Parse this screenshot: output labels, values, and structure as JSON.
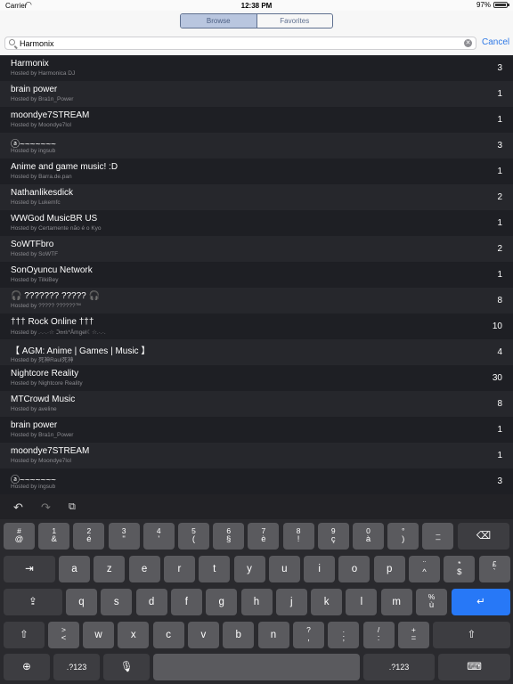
{
  "status": {
    "carrier": "Carrier",
    "time": "12:38 PM",
    "battery": "97%",
    "battery_level": 0.97
  },
  "tabs": [
    {
      "label": "Browse",
      "active": true
    },
    {
      "label": "Favorites",
      "active": false
    }
  ],
  "search": {
    "value": "Harmonix",
    "cancel_label": "Cancel"
  },
  "results": [
    {
      "title": "Harmonix",
      "host": "Hosted by Harmonica DJ",
      "count": "3"
    },
    {
      "title": "brain power",
      "host": "Hosted by Bra1n_Power",
      "count": "1"
    },
    {
      "title": "moondye7STREAM",
      "host": "Hosted by Moondye7lol",
      "count": "1"
    },
    {
      "title": "ⓐ~~~~~~~",
      "host": "Hosted by ingsub",
      "count": "3"
    },
    {
      "title": "Anime and game music! :D",
      "host": "Hosted by Barra.de.pan",
      "count": "1"
    },
    {
      "title": "Nathanlikesdick",
      "host": "Hosted by Lukemfc",
      "count": "2"
    },
    {
      "title": "WWGod MusicBR US",
      "host": "Hosted by Certamente não é o Kyo",
      "count": "1"
    },
    {
      "title": "SoWTFbro",
      "host": "Hosted by SoWTF",
      "count": "2"
    },
    {
      "title": "SonOyuncu Network",
      "host": "Hosted by TilkiBey",
      "count": "1"
    },
    {
      "title": "🎧 ??????? ????? 🎧",
      "host": "Hosted by ????? ??????™",
      "count": "8"
    },
    {
      "title": "††† Rock Online †††",
      "host": "Hosted by .·.·.·☆ ℑ𝔞𝔫𝔨*Åmgel☾☆.·.·.",
      "count": "10"
    },
    {
      "title": "【 AGM: Anime | Games | Music 】",
      "host": "Hosted by 死神Raul死神",
      "count": "4"
    },
    {
      "title": "Nightcore Reality",
      "host": "Hosted by Nightcore Reality",
      "count": "30"
    },
    {
      "title": "MTCrowd Music",
      "host": "Hosted by aveline",
      "count": "8"
    },
    {
      "title": "brain power",
      "host": "Hosted by Bra1n_Power",
      "count": "1"
    },
    {
      "title": "moondye7STREAM",
      "host": "Hosted by Moondye7lol",
      "count": "1"
    },
    {
      "title": "ⓐ~~~~~~~",
      "host": "Hosted by ingsub",
      "count": "3"
    }
  ],
  "keyboard": {
    "toolbar": {
      "undo": "↶",
      "redo": "↷",
      "paste": "⧉"
    },
    "row1": [
      {
        "top": "#",
        "bot": "@"
      },
      {
        "top": "1",
        "bot": "&"
      },
      {
        "top": "2",
        "bot": "é"
      },
      {
        "top": "3",
        "bot": "\""
      },
      {
        "top": "4",
        "bot": "'"
      },
      {
        "top": "5",
        "bot": "("
      },
      {
        "top": "6",
        "bot": "§"
      },
      {
        "top": "7",
        "bot": "è"
      },
      {
        "top": "8",
        "bot": "!"
      },
      {
        "top": "9",
        "bot": "ç"
      },
      {
        "top": "0",
        "bot": "à"
      },
      {
        "top": "°",
        "bot": ")"
      },
      {
        "top": "_",
        "bot": "–"
      }
    ],
    "delete": "⌫",
    "tab": "⇥",
    "row2": [
      "a",
      "z",
      "e",
      "r",
      "t",
      "y",
      "u",
      "i",
      "o",
      "p"
    ],
    "row2_extra": [
      {
        "top": "¨",
        "bot": "^"
      },
      {
        "top": "*",
        "bot": "$"
      },
      {
        "top": "£",
        "bot": "`"
      }
    ],
    "capslock": "⇪",
    "row3": [
      "q",
      "s",
      "d",
      "f",
      "g",
      "h",
      "j",
      "k",
      "l",
      "m"
    ],
    "row3_extra": {
      "top": "%",
      "bot": "ù"
    },
    "return": "↵",
    "shift": "⇧",
    "row4_first": {
      "top": ">",
      "bot": "<"
    },
    "row4": [
      "w",
      "x",
      "c",
      "v",
      "b",
      "n"
    ],
    "row4_extra": [
      {
        "top": "?",
        "bot": ","
      },
      {
        "top": ".",
        "bot": ";"
      },
      {
        "top": "/",
        "bot": ":"
      },
      {
        "top": "+",
        "bot": "="
      }
    ],
    "globe": "⊕",
    "numbers": ".?123",
    "mic": "🎙",
    "hide": "⌨"
  }
}
